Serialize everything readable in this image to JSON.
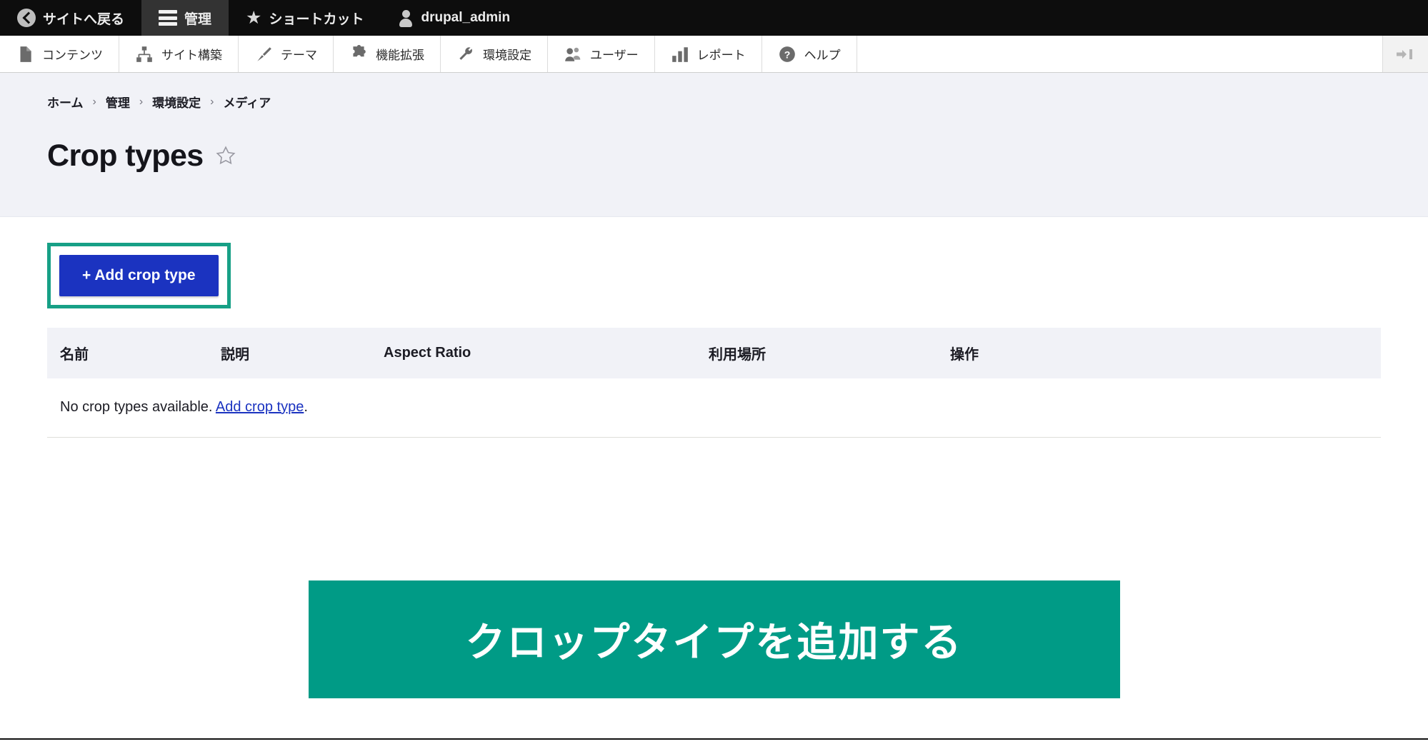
{
  "admin_bar": {
    "items": [
      {
        "label": "サイトへ戻る",
        "icon": "back-circle-icon",
        "active": false
      },
      {
        "label": "管理",
        "icon": "hamburger-icon",
        "active": true
      },
      {
        "label": "ショートカット",
        "icon": "star-filled-icon",
        "active": false
      },
      {
        "label": "drupal_admin",
        "icon": "user-icon",
        "active": false
      }
    ]
  },
  "menu_bar": {
    "items": [
      {
        "label": "コンテンツ",
        "icon": "document-icon"
      },
      {
        "label": "サイト構築",
        "icon": "sitemap-icon"
      },
      {
        "label": "テーマ",
        "icon": "paintbrush-icon"
      },
      {
        "label": "機能拡張",
        "icon": "puzzle-piece-icon"
      },
      {
        "label": "環境設定",
        "icon": "wrench-icon"
      },
      {
        "label": "ユーザー",
        "icon": "people-icon"
      },
      {
        "label": "レポート",
        "icon": "bar-chart-icon"
      },
      {
        "label": "ヘルプ",
        "icon": "question-mark-icon"
      }
    ],
    "collapse_icon": "collapse-sidebar-icon"
  },
  "page_header": {
    "breadcrumb": [
      "ホーム",
      "管理",
      "環境設定",
      "メディア"
    ],
    "separator": "›",
    "title": "Crop types",
    "favorite_icon": "star-outline-icon"
  },
  "actions": {
    "add_button_label": "+ Add crop type",
    "highlight_color": "#17a086",
    "button_color": "#1b33c0"
  },
  "table": {
    "columns": [
      "名前",
      "説明",
      "Aspect Ratio",
      "利用場所",
      "操作"
    ],
    "empty_message_prefix": "No crop types available. ",
    "empty_message_link": "Add crop type",
    "empty_message_suffix": ".",
    "rows": []
  },
  "banner": {
    "text": "クロップタイプを追加する",
    "background_color": "#009b86",
    "text_color": "#ffffff"
  }
}
